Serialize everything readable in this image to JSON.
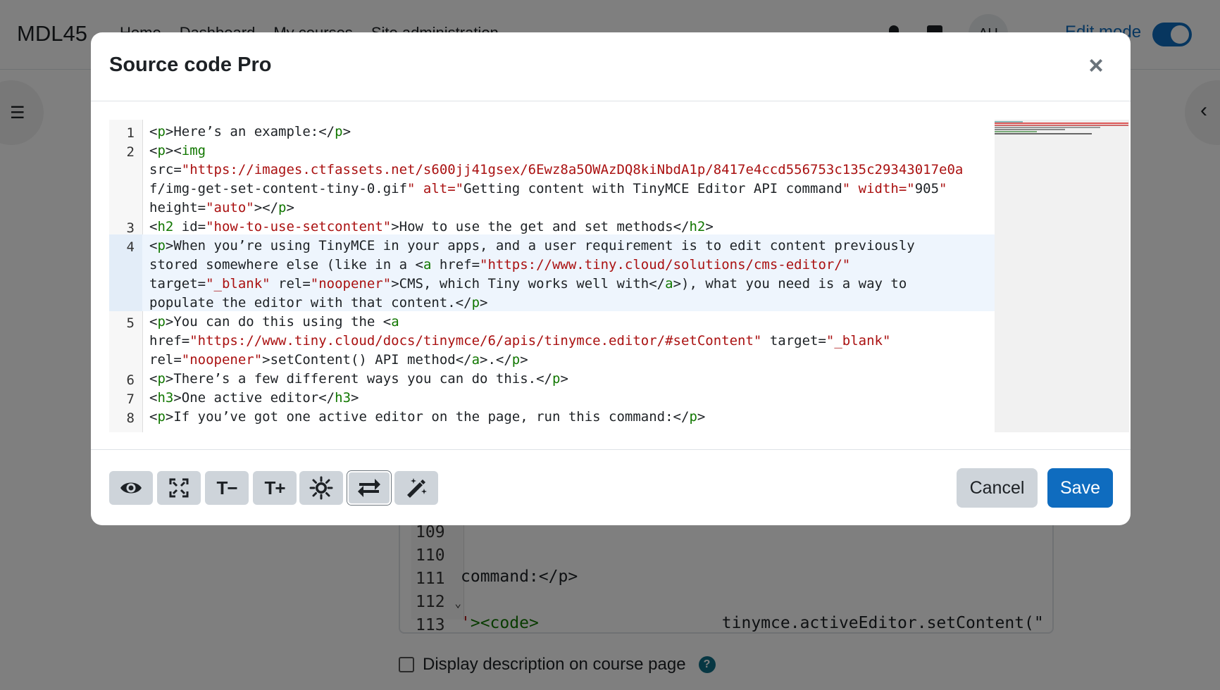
{
  "site": {
    "brand": "MDL45",
    "nav": [
      "Home",
      "Dashboard",
      "My courses",
      "Site administration"
    ],
    "avatar_initials": "AU",
    "edit_mode_label": "Edit mode"
  },
  "background_editor": {
    "line_numbers": [
      "109",
      "110",
      "111",
      "112",
      "113"
    ],
    "line_111": "command:</p>",
    "line_113_tag": "><code>",
    "line_113_text": "tinymce.activeEditor.setContent(\""
  },
  "display_description_label": "Display description on course page",
  "modal": {
    "title": "Source code Pro",
    "close_symbol": "×",
    "lines": [
      {
        "num": "1"
      },
      {
        "num": "2"
      },
      {
        "num": "3"
      },
      {
        "num": "4"
      },
      {
        "num": "5"
      },
      {
        "num": "6"
      },
      {
        "num": "7"
      },
      {
        "num": "8"
      }
    ],
    "code": {
      "l1": "<p>Here’s an example:</p>",
      "l2a": "<p><img",
      "l2b": "src=\"https://images.ctfassets.net/s600jj41gsex/6Ewz8a5OWAzDQ8kiNbdA1p/8417e4ccd556753c135c29343017e0a",
      "l2c": "f/img-get-set-content-tiny-0.gif\" alt=\"Getting content with TinyMCE Editor API command\" width=\"905\"",
      "l2d": "height=\"auto\"></p>",
      "l3": "<h2 id=\"how-to-use-setcontent\">How to use the get and set methods</h2>",
      "l4a": "<p>When you’re using TinyMCE in your apps, and a user requirement is to edit content previously",
      "l4b": "stored somewhere else (like in a <a href=\"https://www.tiny.cloud/solutions/cms-editor/\"",
      "l4c": "target=\"_blank\" rel=\"noopener\">CMS, which Tiny works well with</a>), what you need is a way to",
      "l4d": "populate the editor with that content.</p>",
      "l5a": "<p>You can do this using the <a",
      "l5b": "href=\"https://www.tiny.cloud/docs/tinymce/6/apis/tinymce.editor/#setContent\" target=\"_blank\"",
      "l5c": "rel=\"noopener\">setContent() API method</a>.</p>",
      "l6": "<p>There’s a few different ways you can do this.</p>",
      "l7": "<h3>One active editor</h3>",
      "l8": "<p>If you’ve got one active editor on the page, run this command:</p>"
    },
    "toolbar": {
      "preview_icon": "eye-icon",
      "fullscreen_icon": "expand-icon",
      "decrease_font_label": "T−",
      "increase_font_label": "T+",
      "theme_icon": "sun-icon",
      "wrap_icon": "swap-arrows-icon",
      "format_icon": "magic-wand-icon"
    },
    "cancel_label": "Cancel",
    "save_label": "Save"
  },
  "colors": {
    "primary": "#0f6cbf",
    "tag": "#117700",
    "string": "#aa1111",
    "active_line": "#eef5fd"
  }
}
